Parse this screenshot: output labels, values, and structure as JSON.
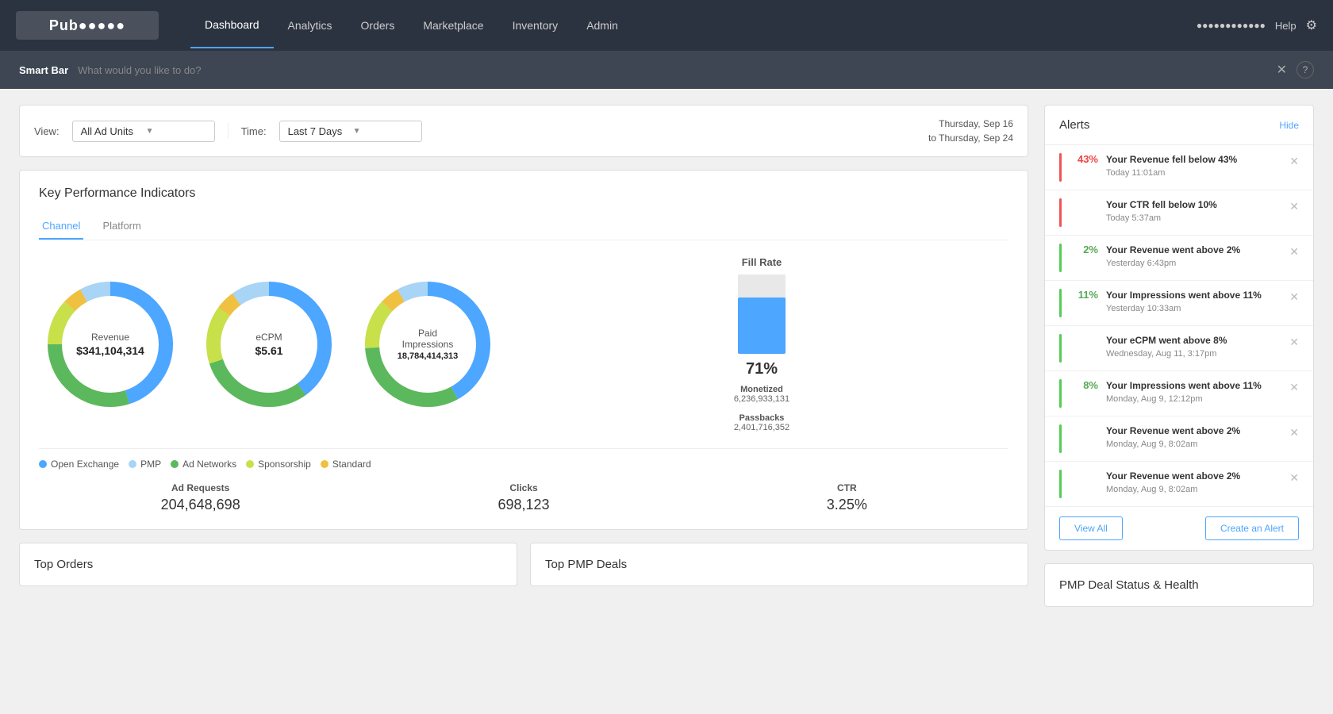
{
  "nav": {
    "logo": "Pub●●●●●",
    "links": [
      "Dashboard",
      "Analytics",
      "Orders",
      "Marketplace",
      "Inventory",
      "Admin"
    ],
    "active_link": "Dashboard",
    "help": "Help",
    "user": "●●●●●●●●●●●●"
  },
  "smart_bar": {
    "label": "Smart Bar",
    "placeholder": "What would you like to do?"
  },
  "filter_bar": {
    "view_label": "View:",
    "view_value": "All Ad Units",
    "time_label": "Time:",
    "time_value": "Last 7 Days",
    "date_range_line1": "Thursday, Sep 16",
    "date_range_line2": "to Thursday, Sep 24"
  },
  "kpi": {
    "title": "Key Performance Indicators",
    "tabs": [
      "Channel",
      "Platform"
    ],
    "active_tab": "Channel",
    "charts": [
      {
        "name": "Revenue",
        "value": "$341,104,314",
        "segments": [
          {
            "color": "#4da6ff",
            "pct": 45
          },
          {
            "color": "#a8d4f5",
            "pct": 8
          },
          {
            "color": "#5cb85c",
            "pct": 30
          },
          {
            "color": "#c8e04a",
            "pct": 12
          },
          {
            "color": "#f0c040",
            "pct": 5
          }
        ]
      },
      {
        "name": "eCPM",
        "value": "$5.61",
        "segments": [
          {
            "color": "#4da6ff",
            "pct": 40
          },
          {
            "color": "#a8d4f5",
            "pct": 10
          },
          {
            "color": "#5cb85c",
            "pct": 30
          },
          {
            "color": "#c8e04a",
            "pct": 15
          },
          {
            "color": "#f0c040",
            "pct": 5
          }
        ]
      },
      {
        "name": "Paid Impressions",
        "value": "18,784,414,313",
        "segments": [
          {
            "color": "#4da6ff",
            "pct": 42
          },
          {
            "color": "#a8d4f5",
            "pct": 8
          },
          {
            "color": "#5cb85c",
            "pct": 32
          },
          {
            "color": "#c8e04a",
            "pct": 13
          },
          {
            "color": "#f0c040",
            "pct": 5
          }
        ]
      }
    ],
    "fill_rate": {
      "title": "Fill Rate",
      "pct": 71,
      "pct_label": "71%",
      "monetized_label": "Monetized",
      "monetized_value": "6,236,933,131",
      "passbacks_label": "Passbacks",
      "passbacks_value": "2,401,716,352"
    },
    "legend": [
      {
        "color": "#4da6ff",
        "label": "Open Exchange"
      },
      {
        "color": "#a8d4f5",
        "label": "PMP"
      },
      {
        "color": "#5cb85c",
        "label": "Ad Networks"
      },
      {
        "color": "#c8e04a",
        "label": "Sponsorship"
      },
      {
        "color": "#f0c040",
        "label": "Standard"
      }
    ],
    "stats": [
      {
        "label": "Ad Requests",
        "value": "204,648,698"
      },
      {
        "label": "Clicks",
        "value": "698,123"
      },
      {
        "label": "CTR",
        "value": "3.25%"
      }
    ]
  },
  "bottom_cards": [
    {
      "title": "Top Orders"
    },
    {
      "title": "Top PMP Deals"
    },
    {
      "title": "PMP Deal Status & Health"
    }
  ],
  "alerts": {
    "title": "Alerts",
    "hide_label": "Hide",
    "items": [
      {
        "indicator": "red",
        "pct": "43%",
        "pct_color": "red",
        "msg": "Your Revenue fell below 43%",
        "time": "Today 11:01am"
      },
      {
        "indicator": "red",
        "pct": "",
        "pct_color": "red",
        "msg": "Your CTR fell below 10%",
        "time": "Today 5:37am"
      },
      {
        "indicator": "green",
        "pct": "2%",
        "pct_color": "green",
        "msg": "Your Revenue went above 2%",
        "time": "Yesterday 6:43pm"
      },
      {
        "indicator": "green",
        "pct": "11%",
        "pct_color": "green",
        "msg": "Your Impressions went above 11%",
        "time": "Yesterday 10:33am"
      },
      {
        "indicator": "green",
        "pct": "",
        "pct_color": "green",
        "msg": "Your eCPM went above 8%",
        "time": "Wednesday, Aug 11, 3:17pm"
      },
      {
        "indicator": "green",
        "pct": "8%",
        "pct_color": "green",
        "msg": "Your Impressions went above 11%",
        "time": "Monday, Aug 9, 12:12pm"
      },
      {
        "indicator": "green",
        "pct": "",
        "pct_color": "green",
        "msg": "Your Revenue went above 2%",
        "time": "Monday, Aug 9, 8:02am"
      },
      {
        "indicator": "green",
        "pct": "",
        "pct_color": "green",
        "msg": "Your Revenue went above 2%",
        "time": "Monday, Aug 9, 8:02am"
      }
    ],
    "view_all_label": "View All",
    "create_alert_label": "Create an Alert"
  }
}
